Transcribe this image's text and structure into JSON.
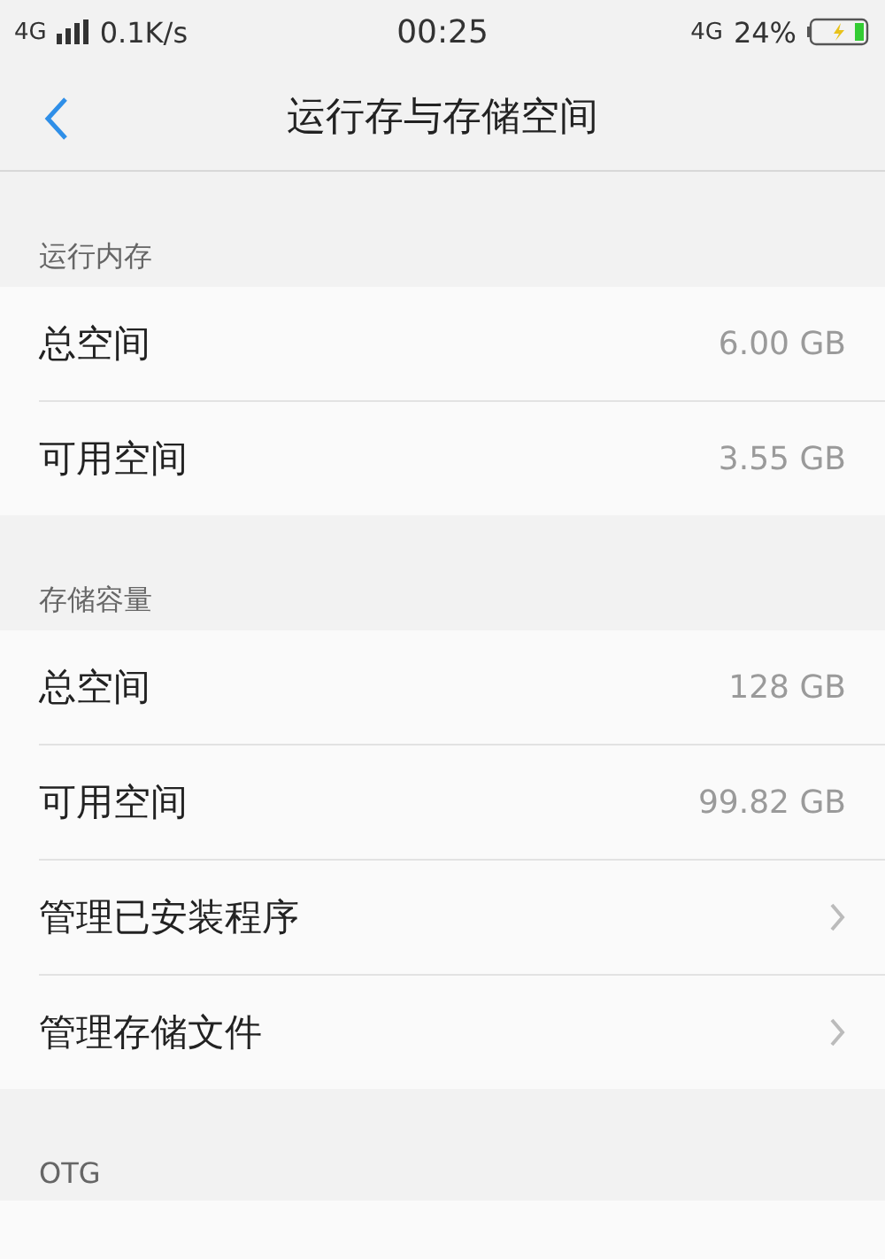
{
  "status_bar": {
    "network": "4G",
    "speed": "0.1K/s",
    "time": "00:25",
    "network_right": "4G",
    "battery": "24%"
  },
  "header": {
    "title": "运行存与存储空间"
  },
  "sections": [
    {
      "title": "运行内存",
      "rows": [
        {
          "kind": "value",
          "label": "总空间",
          "value": "6.00 GB"
        },
        {
          "kind": "value",
          "label": "可用空间",
          "value": "3.55 GB"
        }
      ]
    },
    {
      "title": "存储容量",
      "rows": [
        {
          "kind": "value",
          "label": "总空间",
          "value": "128 GB"
        },
        {
          "kind": "value",
          "label": "可用空间",
          "value": "99.82 GB"
        },
        {
          "kind": "link",
          "label": "管理已安装程序"
        },
        {
          "kind": "link",
          "label": "管理存储文件"
        }
      ]
    },
    {
      "title": "OTG"
    }
  ]
}
